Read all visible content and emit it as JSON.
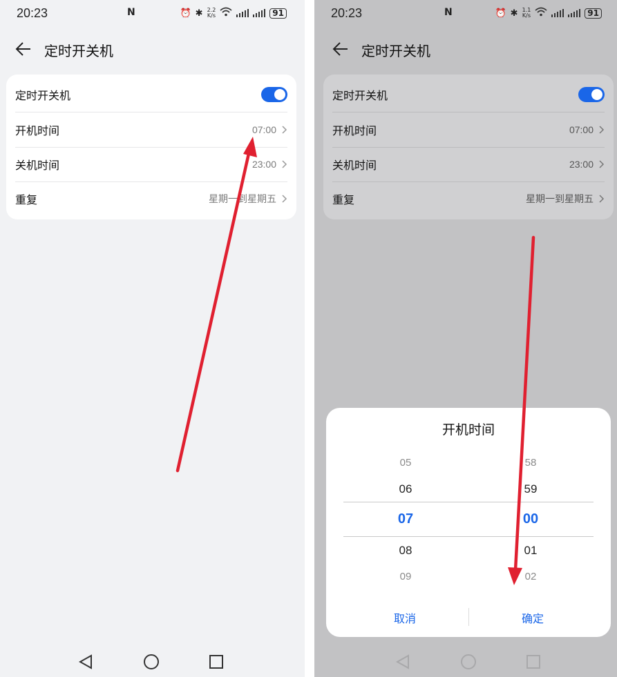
{
  "status": {
    "time": "20:23",
    "nfc": "N",
    "speed_left": "2.2",
    "speed_right": "1.1",
    "speed_unit": "K/s",
    "battery": "91"
  },
  "header": {
    "title": "定时开关机"
  },
  "settings": {
    "rows": [
      {
        "label": "定时开关机",
        "value": ""
      },
      {
        "label": "开机时间",
        "value": "07:00"
      },
      {
        "label": "关机时间",
        "value": "23:00"
      },
      {
        "label": "重复",
        "value": "星期一到星期五"
      }
    ]
  },
  "picker": {
    "title": "开机时间",
    "hours": [
      "05",
      "06",
      "07",
      "08",
      "09"
    ],
    "minutes": [
      "58",
      "59",
      "00",
      "01",
      "02"
    ],
    "cancel": "取消",
    "confirm": "确定"
  },
  "colors": {
    "accent": "#1a66e8",
    "arrow": "#e02030",
    "toggle_on": "#1a66e8"
  },
  "icons": [
    "back-arrow-icon",
    "chevron-right-icon",
    "alarm-icon",
    "bluetooth-icon",
    "wifi-icon",
    "signal-icon",
    "battery-icon",
    "nav-back-icon",
    "nav-home-icon",
    "nav-recents-icon"
  ]
}
